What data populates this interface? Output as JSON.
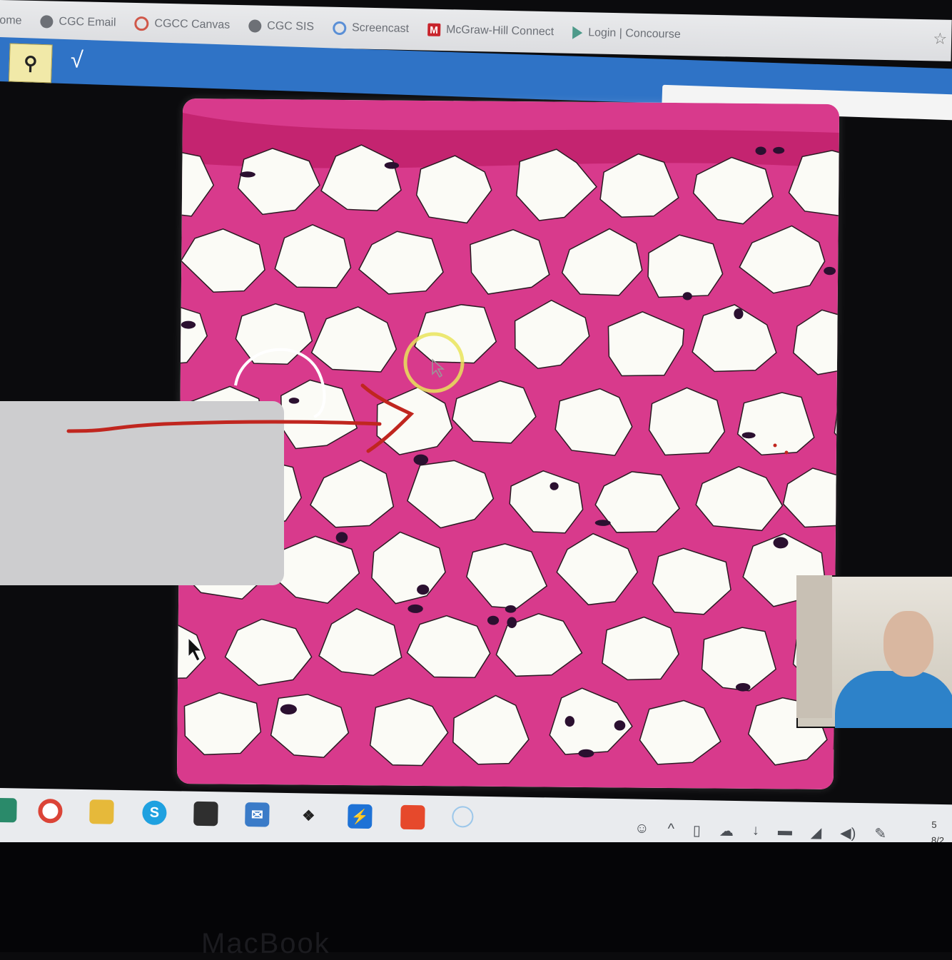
{
  "bookmarks": [
    {
      "label": "ome",
      "icon": "globe-icon"
    },
    {
      "label": "CGC Email",
      "icon": "globe-icon"
    },
    {
      "label": "CGCC Canvas",
      "icon": "canvas-icon"
    },
    {
      "label": "CGC SIS",
      "icon": "globe-icon"
    },
    {
      "label": "Screencast",
      "icon": "screencast-icon"
    },
    {
      "label": "McGraw-Hill Connect",
      "icon": "mcgraw-hill-icon"
    },
    {
      "label": "Login | Concourse",
      "icon": "concourse-icon"
    }
  ],
  "toolbar": {
    "check_label": "√"
  },
  "bottom_text": "MacBook",
  "clock_top": "5",
  "clock_bottom": "8/2",
  "colors": {
    "toolbar_blue": "#2f73c6",
    "stain_pink": "#d83a8c",
    "annotation_red": "#c0261f",
    "highlight_yellow": "#e9e45a"
  }
}
